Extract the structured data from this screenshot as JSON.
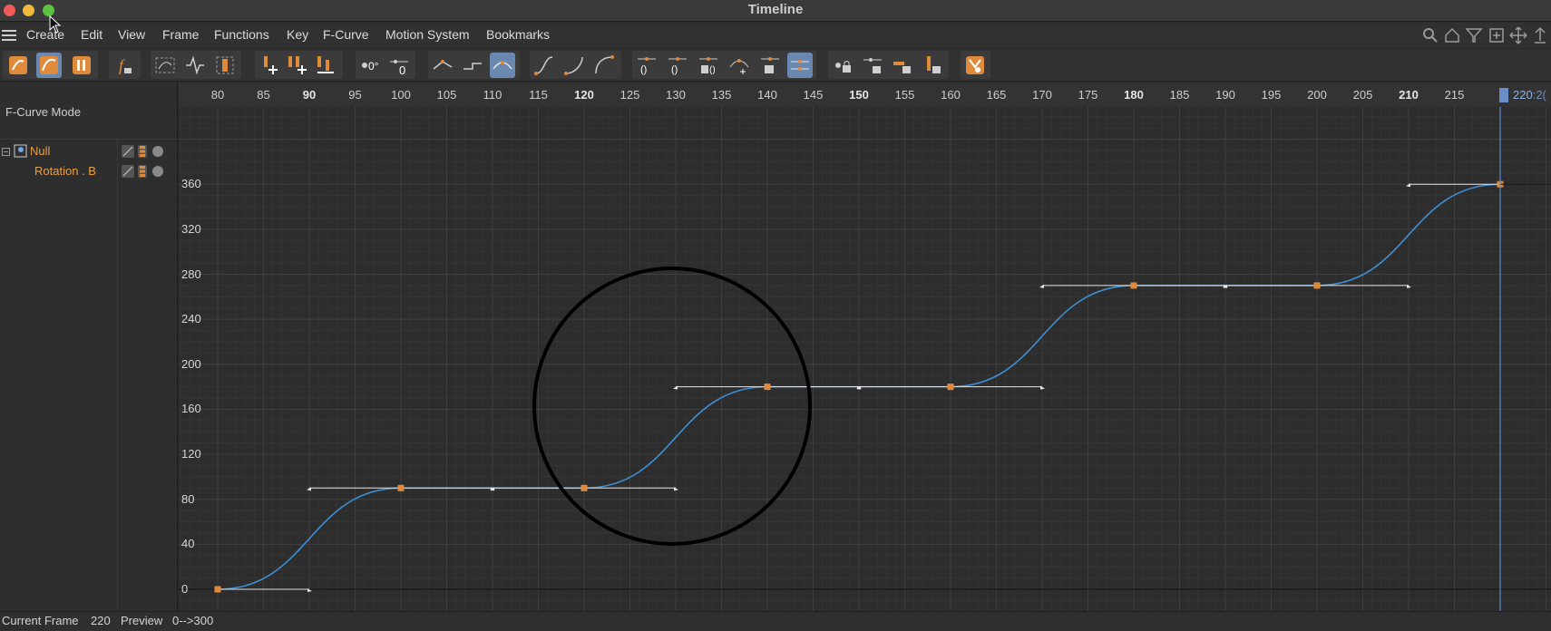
{
  "window": {
    "title": "Timeline"
  },
  "menu": {
    "items": [
      "Create",
      "Edit",
      "View",
      "Frame",
      "Functions",
      "Key",
      "F-Curve",
      "Motion System",
      "Bookmarks"
    ],
    "right_icons": [
      "search-icon",
      "home-icon",
      "filter-icon",
      "add-layer-icon",
      "move-icon",
      "pin-icon"
    ]
  },
  "toolbar": {
    "groups": [
      [
        "key-mode-icon",
        "fcurve-mode-icon",
        "dopesheet-mode-icon"
      ],
      [
        "function-view-icon"
      ],
      [
        "curve-select-icon",
        "wave-icon",
        "range-icon"
      ],
      [
        "add-key-icon",
        "add-keys-icon",
        "insert-key-icon"
      ],
      [
        "zero-angle-icon",
        "zero-length-icon"
      ],
      [
        "linear-tangent-icon",
        "step-tangent-icon",
        "spline-tangent-icon"
      ],
      [
        "ease-in-out-icon",
        "ease-in-icon",
        "ease-out-icon"
      ],
      [
        "auto-tangent-icon",
        "clamp-icon",
        "weighted-icon",
        "remove-overshoot-icon",
        "break-tangent-icon",
        "lock-tangent-icon"
      ],
      [
        "lock-angle-icon",
        "lock-length-icon",
        "lock-value-icon",
        "lock-time-icon"
      ],
      [
        "key-preset-icon"
      ]
    ],
    "active": [
      "fcurve-mode-icon",
      "spline-tangent-icon",
      "lock-tangent-icon"
    ]
  },
  "left_panel": {
    "mode": "F-Curve Mode",
    "tree": [
      {
        "name": "Null"
      },
      {
        "name": "Rotation . B"
      }
    ]
  },
  "ruler": {
    "ticks": [
      "80",
      "85",
      "90",
      "95",
      "100",
      "105",
      "110",
      "115",
      "120",
      "125",
      "130",
      "135",
      "140",
      "145",
      "150",
      "155",
      "160",
      "165",
      "170",
      "175",
      "180",
      "185",
      "190",
      "195",
      "200",
      "205",
      "210",
      "215"
    ],
    "bold_ticks": [
      "90",
      "120",
      "150",
      "180",
      "210"
    ],
    "current": "220",
    "current_suffix": ":2("
  },
  "graph": {
    "y_labels": [
      "360",
      "320",
      "280",
      "240",
      "200",
      "160",
      "120",
      "80",
      "40",
      "0"
    ],
    "keys": [
      {
        "frame": 80,
        "value": 0
      },
      {
        "frame": 100,
        "value": 90
      },
      {
        "frame": 120,
        "value": 90
      },
      {
        "frame": 140,
        "value": 180
      },
      {
        "frame": 160,
        "value": 180
      },
      {
        "frame": 180,
        "value": 270
      },
      {
        "frame": 200,
        "value": 270
      },
      {
        "frame": 220,
        "value": 360
      }
    ],
    "colors": {
      "curve": "#3d8fd6",
      "key": "#e08a3c",
      "tangent": "#e6e6e6",
      "grid": "#3a3a3a",
      "playhead": "#5a8ad6"
    }
  },
  "status": {
    "current_frame_label": "Current Frame",
    "current_frame": "220",
    "preview_label": "Preview",
    "preview_range": "0-->300"
  }
}
